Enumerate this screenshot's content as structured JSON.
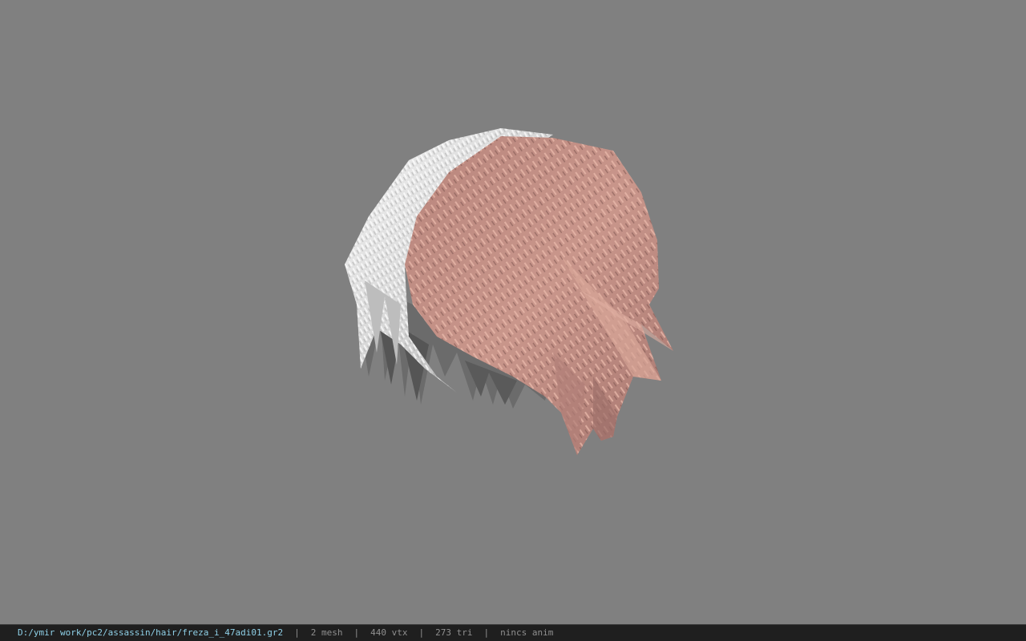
{
  "viewport": {
    "background_color": "#808080",
    "model": {
      "semantic": "hair-mesh",
      "colors": {
        "front_hair": "#c8958a",
        "front_hair_light": "#e6b4a6",
        "front_hair_dark": "#8a5e58",
        "side_hair": "#d8d8d8",
        "side_hair_light": "#f2f2f2",
        "back_hair": "#6a6a6a"
      }
    }
  },
  "statusbar": {
    "file_path": "D:/ymir work/pc2/assassin/hair/freza_i_47adi01.gr2",
    "separator": "|",
    "mesh_count": "2 mesh",
    "vertex_count": "440 vtx",
    "triangle_count": "273 tri",
    "anim_status": "nincs anim",
    "colors": {
      "background": "#1f1f1f",
      "path_text": "#8ecfe6",
      "info_text": "#8f8f8f"
    }
  }
}
